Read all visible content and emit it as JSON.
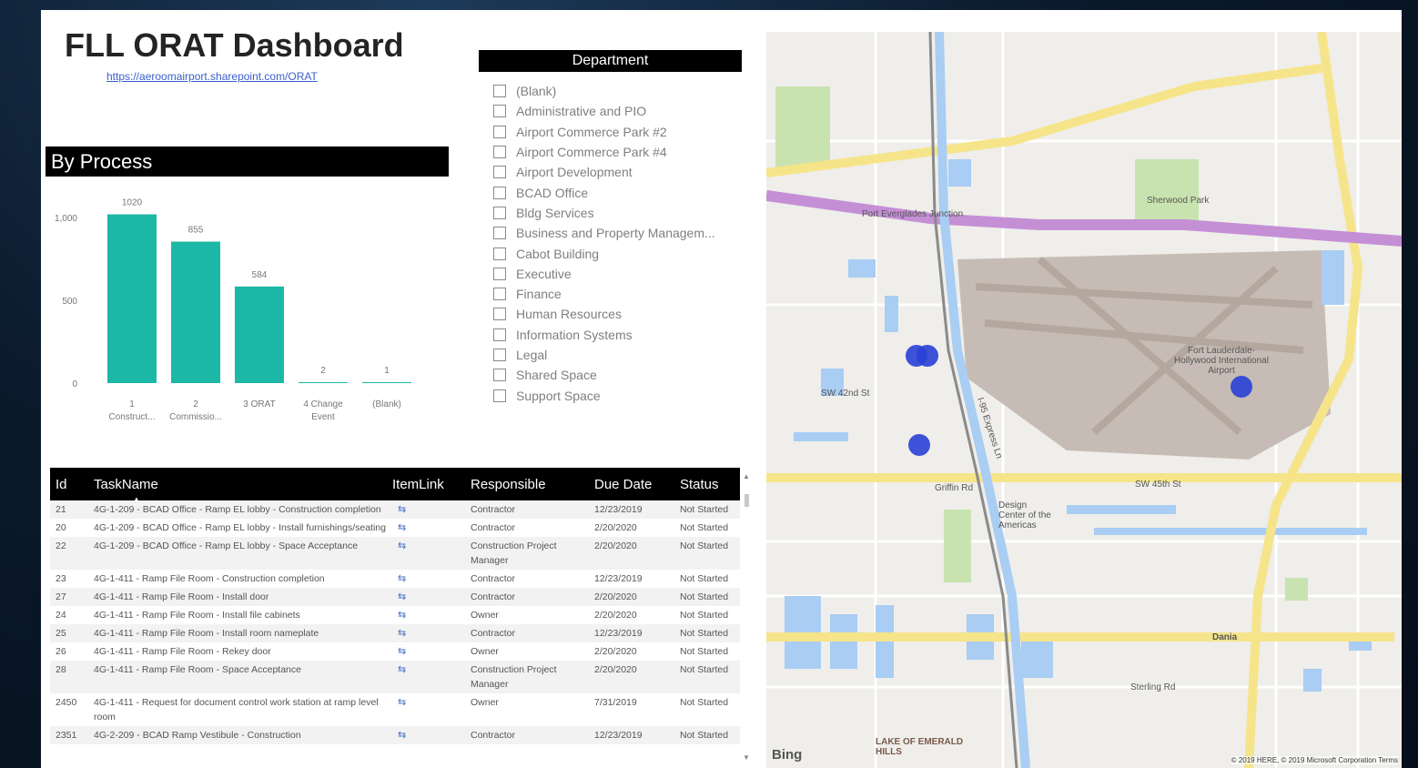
{
  "dashboard": {
    "title": "FLL ORAT Dashboard",
    "link": "https://aeroomairport.sharepoint.com/ORAT"
  },
  "department_slicer": {
    "header": "Department",
    "items": [
      "(Blank)",
      "Administrative and PIO",
      "Airport Commerce Park #2",
      "Airport Commerce Park #4",
      "Airport Development",
      "BCAD Office",
      "Bldg Services",
      "Business and Property Managem...",
      "Cabot Building",
      "Executive",
      "Finance",
      "Human Resources",
      "Information Systems",
      "Legal",
      "Shared Space",
      "Support Space"
    ]
  },
  "by_process": {
    "header": "By Process"
  },
  "chart_data": {
    "type": "bar",
    "title": "By Process",
    "categories": [
      "1 Construct...",
      "2 Commissio...",
      "3 ORAT",
      "4 Change Event",
      "(Blank)"
    ],
    "category_lines": [
      [
        "1",
        "Construct..."
      ],
      [
        "2",
        "Commissio..."
      ],
      [
        "3 ORAT"
      ],
      [
        "4 Change",
        "Event"
      ],
      [
        "(Blank)"
      ]
    ],
    "values": [
      1020,
      855,
      584,
      2,
      1
    ],
    "data_labels": [
      "1020",
      "855",
      "584",
      "2",
      "1"
    ],
    "yticks": [
      "0",
      "500",
      "1,000"
    ],
    "ytick_values": [
      0,
      500,
      1000
    ],
    "ylim": [
      0,
      1100
    ],
    "color": "#1cb8a7",
    "grid": false
  },
  "tasks_table": {
    "columns": [
      "Id",
      "TaskName",
      "ItemLink",
      "Responsible",
      "Due Date",
      "Status"
    ],
    "rows": [
      {
        "id": "21",
        "name": "4G-1-209 - BCAD Office - Ramp EL lobby - Construction completion",
        "link": "⇆",
        "resp": "Contractor",
        "due": "12/23/2019",
        "status": "Not Started"
      },
      {
        "id": "20",
        "name": "4G-1-209 - BCAD Office - Ramp EL lobby - Install furnishings/seating",
        "link": "⇆",
        "resp": "Contractor",
        "due": "2/20/2020",
        "status": "Not Started"
      },
      {
        "id": "22",
        "name": "4G-1-209 - BCAD Office - Ramp EL lobby - Space Acceptance",
        "link": "⇆",
        "resp": "Construction Project Manager",
        "due": "2/20/2020",
        "status": "Not Started"
      },
      {
        "id": "23",
        "name": "4G-1-411 - Ramp File Room - Construction completion",
        "link": "⇆",
        "resp": "Contractor",
        "due": "12/23/2019",
        "status": "Not Started"
      },
      {
        "id": "27",
        "name": "4G-1-411 - Ramp File Room - Install door",
        "link": "⇆",
        "resp": "Contractor",
        "due": "2/20/2020",
        "status": "Not Started"
      },
      {
        "id": "24",
        "name": "4G-1-411 - Ramp File Room - Install file cabinets",
        "link": "⇆",
        "resp": "Owner",
        "due": "2/20/2020",
        "status": "Not Started"
      },
      {
        "id": "25",
        "name": "4G-1-411 - Ramp File Room - Install room nameplate",
        "link": "⇆",
        "resp": "Contractor",
        "due": "12/23/2019",
        "status": "Not Started"
      },
      {
        "id": "26",
        "name": "4G-1-411 - Ramp File Room - Rekey door",
        "link": "⇆",
        "resp": "Owner",
        "due": "2/20/2020",
        "status": "Not Started"
      },
      {
        "id": "28",
        "name": "4G-1-411 - Ramp File Room - Space Acceptance",
        "link": "⇆",
        "resp": "Construction Project Manager",
        "due": "2/20/2020",
        "status": "Not Started"
      },
      {
        "id": "2450",
        "name": "4G-1-411 - Request for document control work station at ramp level room",
        "link": "⇆",
        "resp": "Owner",
        "due": "7/31/2019",
        "status": "Not Started"
      },
      {
        "id": "2351",
        "name": "4G-2-209 - BCAD Ramp Vestibule - Construction",
        "link": "⇆",
        "resp": "Contractor",
        "due": "12/23/2019",
        "status": "Not Started"
      }
    ]
  },
  "map": {
    "labels": {
      "port_everglades": "Port Everglades Junction",
      "airport": "Fort Lauderdale-Hollywood International Airport",
      "griffin_rd": "Griffin Rd",
      "sw_42nd": "SW 42nd St",
      "sw_45th": "SW 45th St",
      "i95": "I-95 Express Ln",
      "dania": "Dania",
      "lake": "LAKE OF EMERALD HILLS",
      "design_center": "Design Center of the Americas",
      "sherwood": "Sherwood Park",
      "sterling": "Sterling Rd",
      "bing": "Bing",
      "copyright": "© 2019 HERE, © 2019 Microsoft Corporation  Terms"
    },
    "pin_count": 4,
    "colors": {
      "pin": "#2940d6",
      "highway": "#c58fd6",
      "major_road": "#f6e48a",
      "water": "#a9cdf3",
      "park": "#c9e3b0",
      "airport": "#c7bcb5"
    }
  }
}
